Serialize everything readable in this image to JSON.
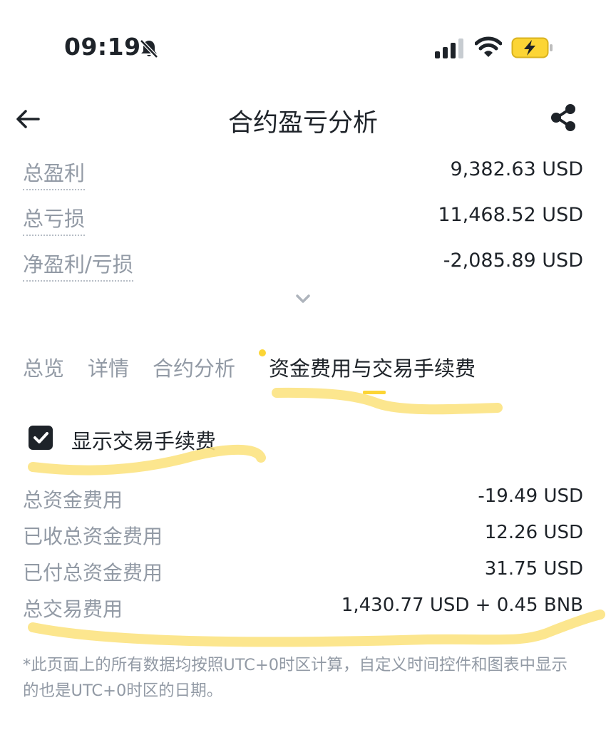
{
  "status_bar": {
    "time": "09:19",
    "icons": [
      "bell-slash-icon",
      "signal-icon",
      "wifi-icon",
      "battery-charging-icon"
    ],
    "battery_color": "#fcd535"
  },
  "nav": {
    "title": "合约盈亏分析",
    "back_icon": "arrow-left-icon",
    "share_icon": "share-icon"
  },
  "summary": {
    "total_profit_label": "总盈利",
    "total_profit_value": "9,382.63 USD",
    "total_loss_label": "总亏损",
    "total_loss_value": "11,468.52 USD",
    "net_label": "净盈利/亏损",
    "net_value": "-2,085.89 USD",
    "expand_icon": "chevron-down-icon"
  },
  "tabs": {
    "overview": "总览",
    "details": "详情",
    "contract_analysis": "合约分析",
    "funding_and_fees": "资金费用与交易手续费",
    "active": "funding_and_fees"
  },
  "fees": {
    "show_fees_label": "显示交易手续费",
    "show_fees_checked": true,
    "total_funding_label": "总资金费用",
    "total_funding_value": "-19.49 USD",
    "received_funding_label": "已收总资金费用",
    "received_funding_value": "12.26 USD",
    "paid_funding_label": "已付总资金费用",
    "paid_funding_value": "31.75 USD",
    "total_trading_fee_label": "总交易费用",
    "total_trading_fee_value": "1,430.77 USD + 0.45 BNB"
  },
  "footnote": "*此页面上的所有数据均按照UTC+0时区计算，自定义时间控件和图表中显示的也是UTC+0时区的日期。",
  "colors": {
    "accent": "#fcd535",
    "text_primary": "#1e2329",
    "text_secondary": "#929aa5",
    "highlighter": "#fbe27a"
  }
}
